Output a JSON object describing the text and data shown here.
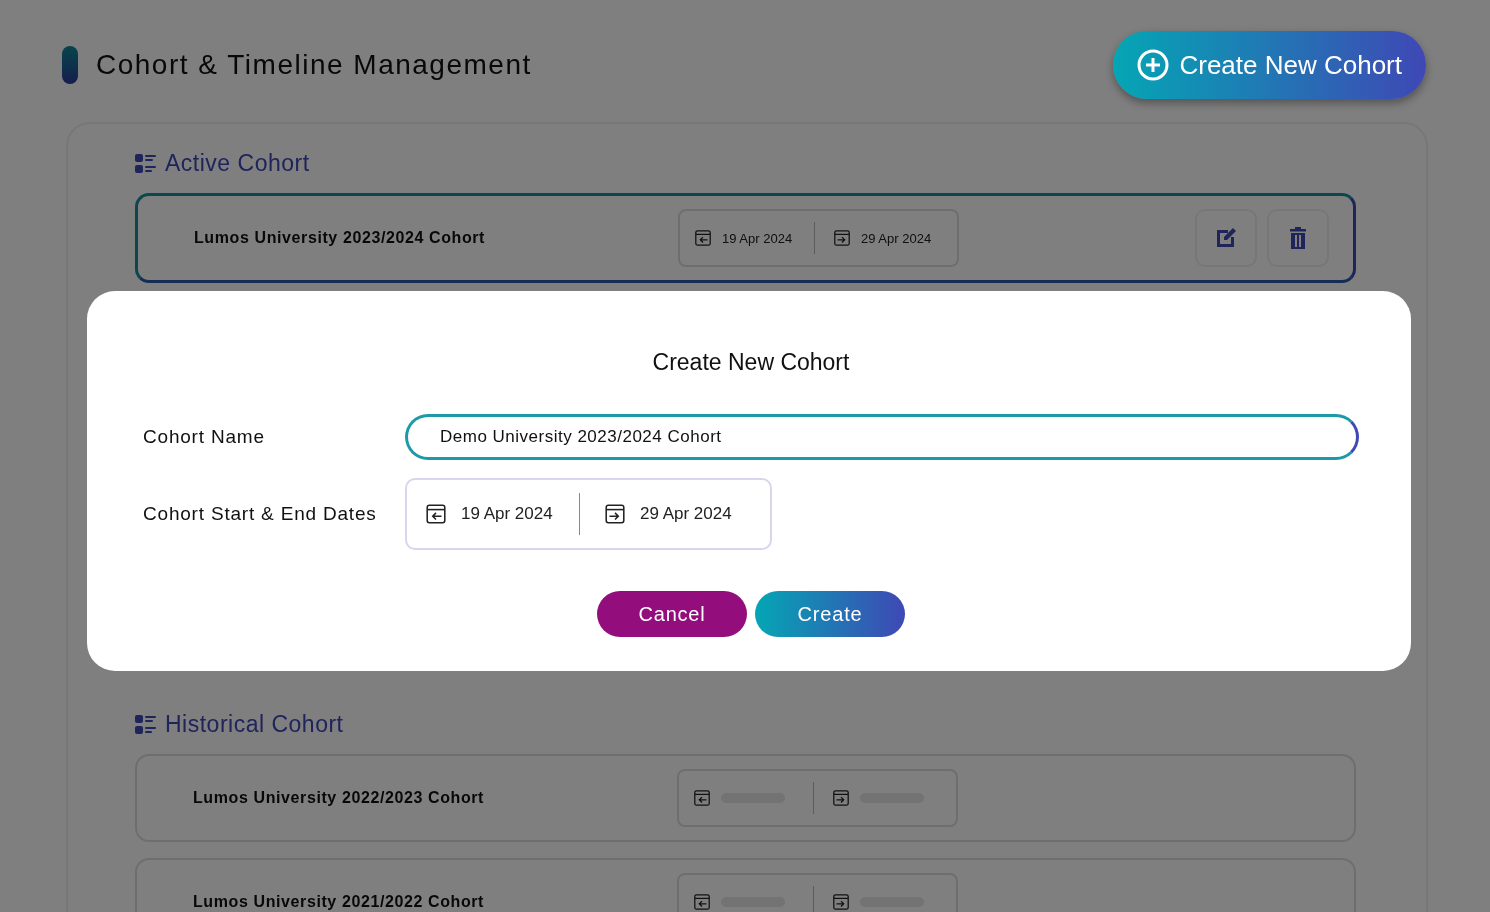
{
  "page": {
    "title": "Cohort & Timeline Management",
    "create_button": "Create New Cohort"
  },
  "active_section": {
    "heading": "Active Cohort",
    "cohorts": [
      {
        "name": "Lumos University 2023/2024 Cohort",
        "start": "19 Apr 2024",
        "end": "29 Apr 2024",
        "loading": false
      }
    ]
  },
  "historical_section": {
    "heading": "Historical Cohort",
    "cohorts": [
      {
        "name": "Lumos University 2022/2023 Cohort",
        "loading": true
      },
      {
        "name": "Lumos University 2021/2022 Cohort",
        "loading": true
      }
    ]
  },
  "dialog": {
    "title": "Create New Cohort",
    "name_label": "Cohort Name",
    "name_value": "Demo University 2023/2024 Cohort",
    "dates_label": "Cohort Start & End Dates",
    "start": "19 Apr 2024",
    "end": "29 Apr 2024",
    "cancel": "Cancel",
    "create": "Create"
  }
}
